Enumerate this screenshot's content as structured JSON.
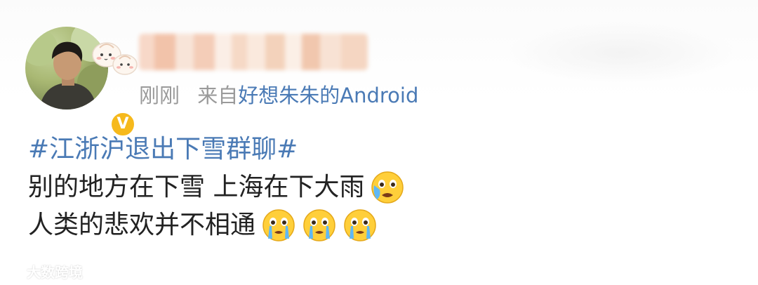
{
  "post": {
    "timestamp": "刚刚",
    "source_prefix": "来自",
    "source_device": "好想朱朱的Android",
    "verified_mark": "V",
    "hashtag": "#江浙沪退出下雪群聊#",
    "line2": "别的地方在下雪 上海在下大雨",
    "line3": "人类的悲欢并不相通",
    "line2_emoji": "crying-face-icon",
    "line3_emojis": [
      "crying-face-icon",
      "crying-face-icon",
      "crying-face-icon"
    ]
  },
  "watermark": {
    "brand": "大数跨境",
    "logo": "weibo-logo-icon"
  },
  "colors": {
    "link_blue": "#4a7ab5",
    "meta_gray": "#9a9a9a",
    "text": "#222222",
    "verified_gold": "#f6b91c"
  }
}
